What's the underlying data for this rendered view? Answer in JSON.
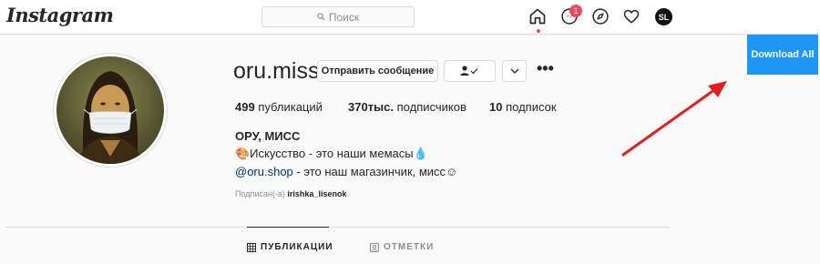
{
  "nav": {
    "logo": "Instagram",
    "search_placeholder": "Поиск",
    "messenger_badge": "1",
    "user_initials": "SL"
  },
  "profile": {
    "username": "oru.miss",
    "message_button": "Отправить сообщение",
    "stats": {
      "posts_count": "499",
      "posts_label": "публикаций",
      "followers_count": "370тыс.",
      "followers_label": "подписчиков",
      "following_count": "10",
      "following_label": "подписок"
    },
    "full_name": "ОРУ, МИСС",
    "bio_line1": "🎨Искусство - это наши мемасы💧",
    "bio_link": "@oru.shop",
    "bio_line2_rest": " - это наш магазинчик, мисс☺",
    "followed_by_prefix": "Подписан(-а)",
    "followed_by_user": "irishka_lisenok"
  },
  "tabs": {
    "posts": "ПУБЛИКАЦИИ",
    "tagged": "ОТМЕТКИ"
  },
  "extension": {
    "download_all": "Download All"
  },
  "colors": {
    "download_bg": "#1e96f5",
    "arrow": "#e02020",
    "badge": "#ed4956"
  }
}
